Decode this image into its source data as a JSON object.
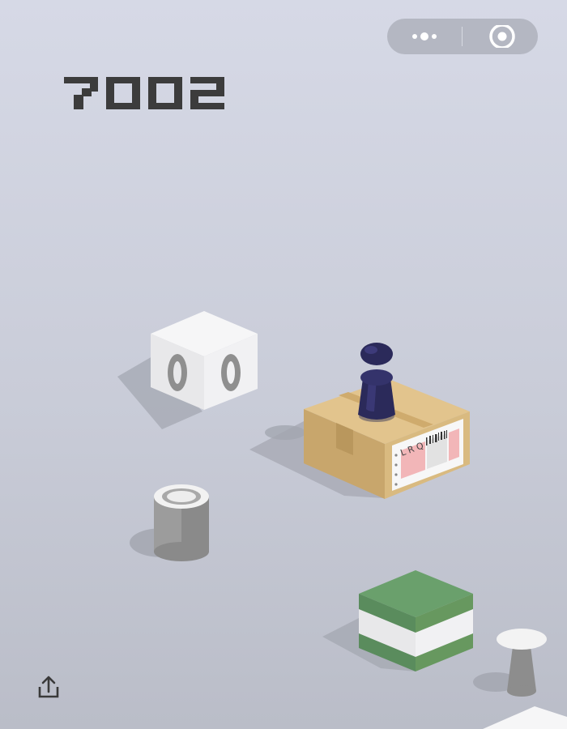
{
  "game": {
    "score": "7002",
    "box_label_text": "L R Q"
  },
  "header": {
    "more_icon": "more-dots-icon",
    "close_icon": "target-circle-icon"
  },
  "footer": {
    "share_icon": "share-upload-icon"
  },
  "colors": {
    "background_top": "#d6d9e6",
    "score": "#3c3c3c",
    "capsule": "#b4b7c2",
    "player": "#2b2a5a",
    "cardboard": "#cfae74",
    "green_block": "#5f9164"
  }
}
